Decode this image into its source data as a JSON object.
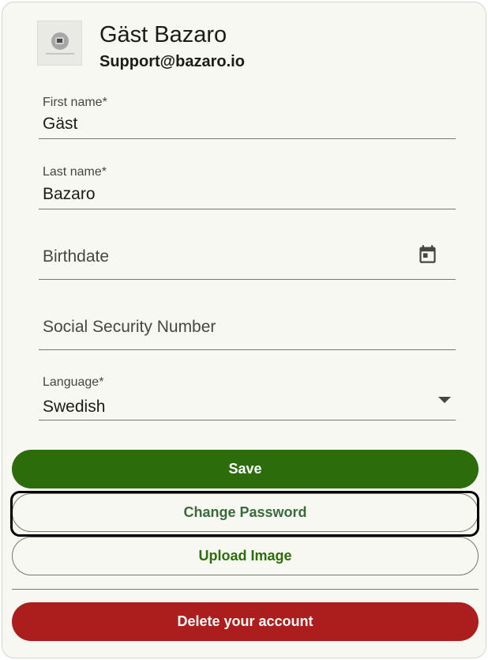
{
  "profile": {
    "name": "Gäst Bazaro",
    "email": "Support@bazaro.io",
    "avatar_icon": "image-placeholder-icon"
  },
  "form": {
    "first_name": {
      "label": "First name*",
      "value": "Gäst"
    },
    "last_name": {
      "label": "Last name*",
      "value": "Bazaro"
    },
    "birthdate": {
      "placeholder": "Birthdate",
      "icon": "calendar-icon"
    },
    "ssn": {
      "placeholder": "Social Security Number"
    },
    "language": {
      "label": "Language*",
      "value": "Swedish",
      "icon": "dropdown-arrow-icon"
    }
  },
  "actions": {
    "save_label": "Save",
    "change_password_label": "Change Password",
    "upload_image_label": "Upload Image",
    "delete_account_label": "Delete your account"
  },
  "colors": {
    "primary": "#2c6c0b",
    "danger": "#ac1d1d",
    "background": "#f8f8f2"
  }
}
